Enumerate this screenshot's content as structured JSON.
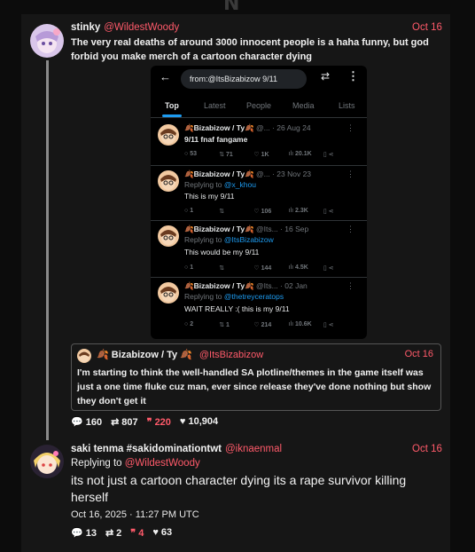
{
  "top_glyph": "N",
  "post1": {
    "name": "stinky",
    "handle": "@WildestWoody",
    "date": "Oct 16",
    "text": "The very real deaths of around 3000 innocent people is a haha funny, but god forbid you make merch of a cartoon character dying",
    "stats": {
      "replies": "160",
      "reposts": "807",
      "quotes": "220",
      "likes": "10,904"
    }
  },
  "embed": {
    "search_value": "from:@ItsBizabizow 9/11",
    "tabs": [
      "Top",
      "Latest",
      "People",
      "Media",
      "Lists"
    ],
    "active_tab": "Top",
    "tweets": [
      {
        "name": "🍂Bizabizow / Ty🍂",
        "handle": "@...",
        "date": "· 26 Aug 24",
        "reply_to": "",
        "text": "9/11 fnaf fangame",
        "replies": "53",
        "reposts": "71",
        "likes": "1K",
        "views": "20.1K"
      },
      {
        "name": "🍂Bizabizow / Ty🍂",
        "handle": "@...",
        "date": "· 23 Nov 23",
        "reply_to": "@x_khou",
        "text": "This is my 9/11",
        "replies": "1",
        "reposts": "",
        "likes": "106",
        "views": "2.3K"
      },
      {
        "name": "🍂Bizabizow / Ty🍂",
        "handle": "@Its...",
        "date": "· 16 Sep",
        "reply_to": "@ItsBizabizow",
        "text": "This would be my 9/11",
        "replies": "1",
        "reposts": "",
        "likes": "144",
        "views": "4.5K"
      },
      {
        "name": "🍂Bizabizow / Ty🍂",
        "handle": "@Its...",
        "date": "· 02 Jan",
        "reply_to": "@thetreyceratops",
        "text": "WAIT REALLY :( this is my 9/11",
        "replies": "2",
        "reposts": "1",
        "likes": "214",
        "views": "10.6K"
      }
    ],
    "replying_to_label": "Replying to"
  },
  "quote": {
    "name": "🍂 Bizabizow / Ty 🍂",
    "handle": "@ItsBizabizow",
    "date": "Oct 16",
    "text": "I'm starting to think the well-handled SA plotline/themes in the game itself was just a one time fluke cuz man, ever since release they've done nothing but show they don't get it"
  },
  "post2": {
    "name": "saki tenma #sakidominationtwt",
    "handle": "@iknaenmal",
    "date": "Oct 16",
    "reply_label": "Replying to",
    "reply_handle": "@WildestWoody",
    "text": "its not just a cartoon character dying its a rape survivor killing herself",
    "timestamp": "Oct 16, 2025 · 11:27 PM UTC",
    "stats": {
      "replies": "13",
      "reposts": "2",
      "quotes": "4",
      "likes": "63"
    }
  },
  "colors": {
    "accent": "#ff5a6a",
    "link": "#1d9bf0",
    "background": "#161616"
  },
  "icons": [
    "reply-icon",
    "repost-icon",
    "quote-icon",
    "heart-icon",
    "back-arrow-icon",
    "filter-icon",
    "more-icon"
  ]
}
